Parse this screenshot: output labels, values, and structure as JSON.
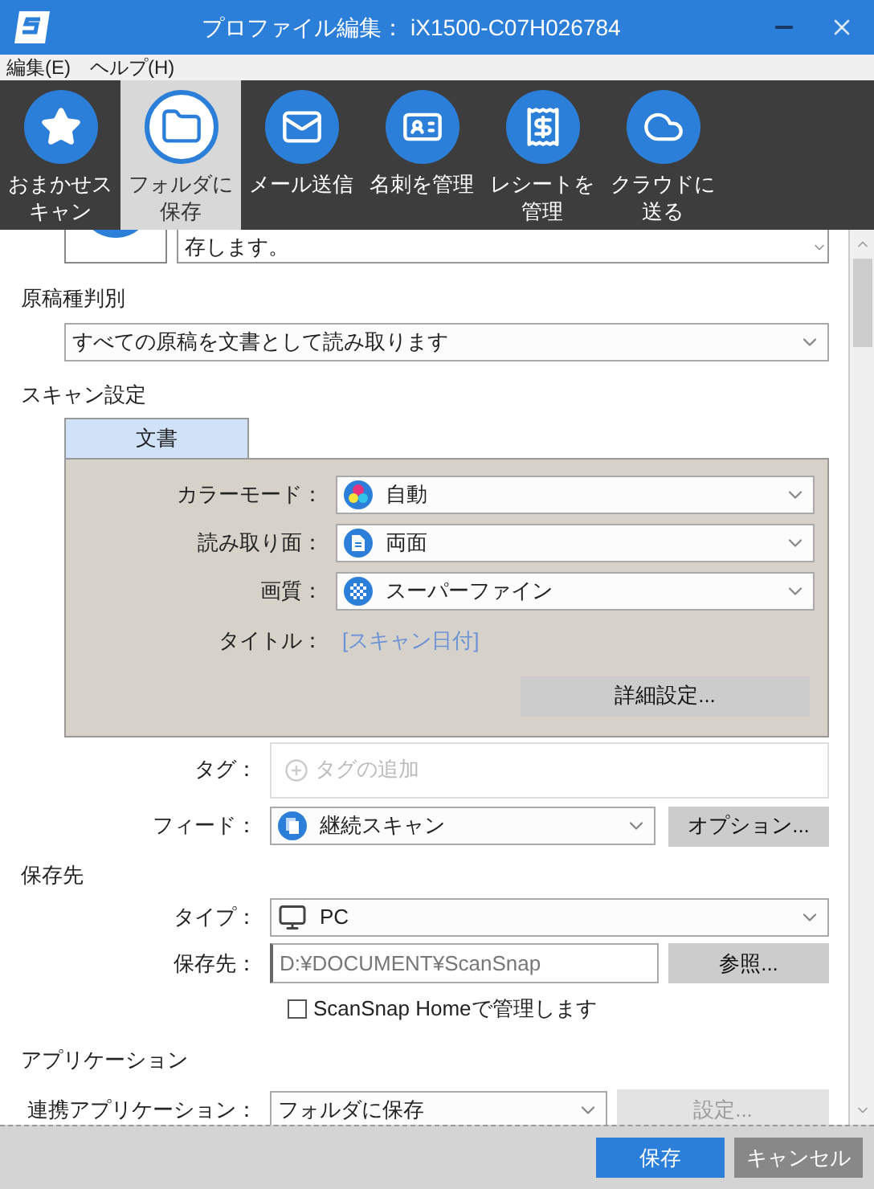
{
  "window": {
    "title": "プロファイル編集： iX1500-C07H026784"
  },
  "menu": [
    "編集(E)",
    "ヘルプ(H)"
  ],
  "toolbar": [
    {
      "label": "おまかせスキャン",
      "kind": "star",
      "selected": false
    },
    {
      "label": "フォルダに保存",
      "kind": "folder",
      "selected": true
    },
    {
      "label": "メール送信",
      "kind": "mail",
      "selected": false
    },
    {
      "label": "名刺を管理",
      "kind": "card",
      "selected": false
    },
    {
      "label": "レシートを管理",
      "kind": "receipt",
      "selected": false
    },
    {
      "label": "クラウドに送る",
      "kind": "cloud",
      "selected": false
    }
  ],
  "description": {
    "text": "存します。"
  },
  "doc_type": {
    "label": "原稿種判別",
    "value": "すべての原稿を文書として読み取ります"
  },
  "scan_settings": {
    "label": "スキャン設定",
    "tabs": [
      {
        "label": "文書",
        "selected": true
      }
    ],
    "rows": [
      {
        "label": "カラーモード：",
        "value": "自動",
        "kind": "color"
      },
      {
        "label": "読み取り面：",
        "value": "両面",
        "kind": "duplex"
      },
      {
        "label": "画質：",
        "value": "スーパーファイン",
        "kind": "quality"
      }
    ],
    "title": {
      "label": "タイトル：",
      "value": "[スキャン日付]"
    },
    "detail_button": "詳細設定..."
  },
  "tag": {
    "label": "タグ：",
    "placeholder": "タグの追加"
  },
  "feed": {
    "label": "フィード：",
    "value": "継続スキャン",
    "button": "オプション..."
  },
  "destination": {
    "label": "保存先",
    "type": {
      "label": "タイプ：",
      "value": "PC"
    },
    "path": {
      "label": "保存先：",
      "value": "D:¥DOCUMENT¥ScanSnap",
      "button": "参照..."
    },
    "manage": {
      "label": "ScanSnap Homeで管理します",
      "checked": false
    }
  },
  "application": {
    "label": "アプリケーション",
    "app": {
      "label": "連携アプリケーション：",
      "value": "フォルダに保存",
      "button": "設定...",
      "button_disabled": true
    }
  },
  "footer": {
    "save": "保存",
    "cancel": "キャンセル"
  }
}
